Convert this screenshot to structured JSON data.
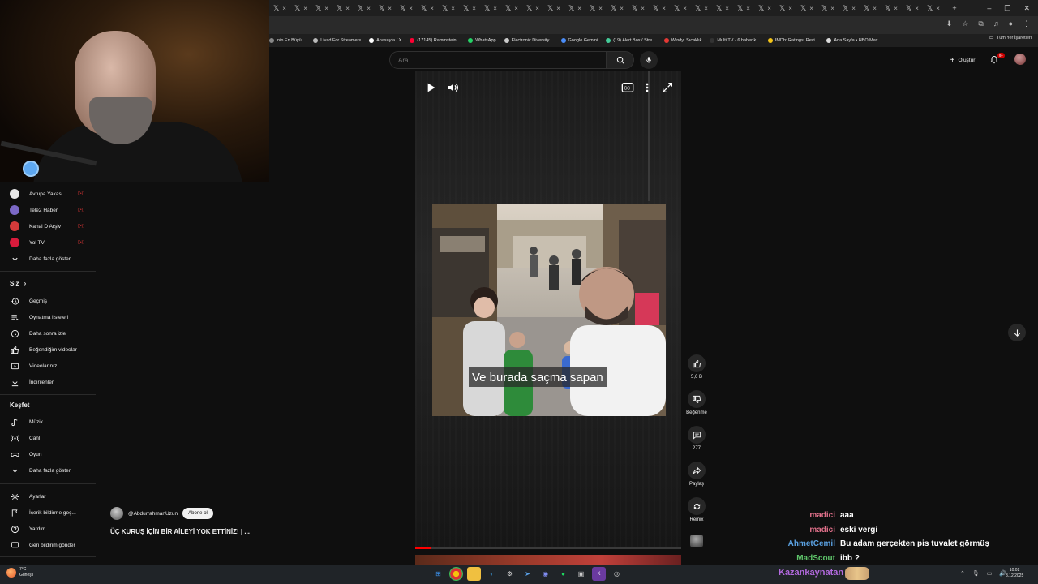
{
  "browser": {
    "bookmarks": [
      {
        "label": "'nin En Büyü...",
        "color": "#888888"
      },
      {
        "label": "Livad For Streamers",
        "color": "#bbbbbb"
      },
      {
        "label": "Anasayfa / X",
        "color": "#ffffff"
      },
      {
        "label": "(17145) Rammstein...",
        "color": "#ff0033"
      },
      {
        "label": "WhatsApp",
        "color": "#25d366"
      },
      {
        "label": "Electronic Diversity...",
        "color": "#cccccc"
      },
      {
        "label": "Google Gemini",
        "color": "#4a8df8"
      },
      {
        "label": "(19) Alert Box / Stre...",
        "color": "#44cc99"
      },
      {
        "label": "Windy: Sıcaklık",
        "color": "#e53935"
      },
      {
        "label": "Multi TV - 6 haber k...",
        "color": "#333333"
      },
      {
        "label": "IMDb: Ratings, Revi...",
        "color": "#f5c518"
      },
      {
        "label": "Ana Sayfa • HBO Max",
        "color": "#dddddd"
      }
    ],
    "all_bookmarks": "Tüm Yer İşaretleri"
  },
  "youtube": {
    "search_placeholder": "Ara",
    "create_label": "Oluştur",
    "notif_badge": "9+"
  },
  "sidebar": {
    "channels": [
      {
        "label": "Avrupa Yakası",
        "color": "#e8e8e8",
        "live": "((•))"
      },
      {
        "label": "Tele2 Haber",
        "color": "#7b68c6",
        "live": "((•))"
      },
      {
        "label": "Kanal D Arşiv",
        "color": "#d43a3a",
        "live": "((•))"
      },
      {
        "label": "Yol TV",
        "color": "#d81b3c",
        "live": "((•))"
      }
    ],
    "show_more_1": "Daha fazla göster",
    "you_heading": "Siz",
    "you_items": [
      {
        "label": "Geçmiş",
        "icon": "history"
      },
      {
        "label": "Oynatma listeleri",
        "icon": "playlist"
      },
      {
        "label": "Daha sonra izle",
        "icon": "clock"
      },
      {
        "label": "Beğendiğim videolar",
        "icon": "like"
      },
      {
        "label": "Videolarınız",
        "icon": "video"
      },
      {
        "label": "İndirilenler",
        "icon": "download"
      }
    ],
    "explore_heading": "Keşfet",
    "explore_items": [
      {
        "label": "Müzik",
        "icon": "music"
      },
      {
        "label": "Canlı",
        "icon": "live"
      },
      {
        "label": "Oyun",
        "icon": "game"
      }
    ],
    "show_more_2": "Daha fazla göster",
    "footer_items": [
      {
        "label": "Ayarlar",
        "icon": "gear"
      },
      {
        "label": "İçerik bildirme geç...",
        "icon": "flag"
      },
      {
        "label": "Yardım",
        "icon": "help"
      },
      {
        "label": "Geri bildirim gönder",
        "icon": "feedback"
      }
    ]
  },
  "short": {
    "caption": "Ve burada saçma sapan",
    "channel": "@AbdurrahmanUzun",
    "subscribe": "Abone ol",
    "title": "ÜÇ KURUŞ İÇİN BİR AİLEYİ YOK ETTİNİZ! | ...",
    "progress": 0.06,
    "actions": {
      "like": "5,6 B",
      "dislike": "Beğenme",
      "comments": "277",
      "share": "Paylaş",
      "remix": "Remix"
    }
  },
  "chat": [
    {
      "user": "madici",
      "msg": "aaa",
      "color": "#e0708a"
    },
    {
      "user": "madici",
      "msg": "eski vergi",
      "color": "#e0708a"
    },
    {
      "user": "AhmetCemil",
      "msg": "Bu adam gerçekten pis tuvalet görmüş",
      "color": "#5aa0e0"
    },
    {
      "user": "MadScout",
      "msg": "ibb ?",
      "color": "#5ec46a"
    }
  ],
  "taskbar": {
    "weather_temp": "7°C",
    "weather_cond": "Güneşli",
    "streamer": "Kazankaynatan",
    "time": "10:02",
    "date": "3.12.2025"
  }
}
